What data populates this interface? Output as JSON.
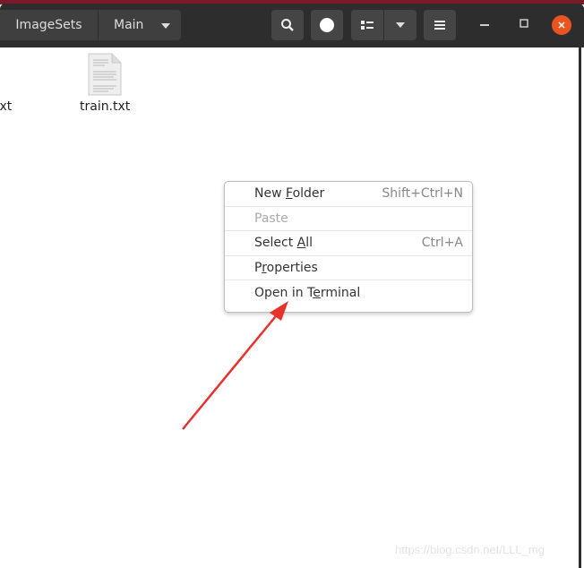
{
  "window": {
    "close_color": "#e95420",
    "header_color": "#2d2d2d"
  },
  "breadcrumb": [
    {
      "label": "ImageSets"
    },
    {
      "label": "Main"
    }
  ],
  "files": [
    {
      "name": "txt",
      "partial": true
    },
    {
      "name": "train.txt"
    }
  ],
  "toolbar": {
    "search": "search-icon",
    "view": "list-view-icon",
    "menu": "hamburger-icon"
  },
  "context_menu": {
    "items": [
      {
        "pre": "New ",
        "mn": "F",
        "post": "older",
        "accel": "Shift+Ctrl+N",
        "disabled": false
      },
      {
        "pre": "Paste",
        "mn": "",
        "post": "",
        "accel": "",
        "disabled": true
      },
      {
        "pre": "Select ",
        "mn": "A",
        "post": "ll",
        "accel": "Ctrl+A",
        "disabled": false
      },
      {
        "pre": "P",
        "mn": "r",
        "post": "operties",
        "accel": "",
        "disabled": false
      },
      {
        "pre": "Open in T",
        "mn": "e",
        "post": "rminal",
        "accel": "",
        "disabled": false
      }
    ]
  },
  "annotation": {
    "arrow_color": "#e8322c"
  },
  "watermark": "https://blog.csdn.net/LLL_mg"
}
